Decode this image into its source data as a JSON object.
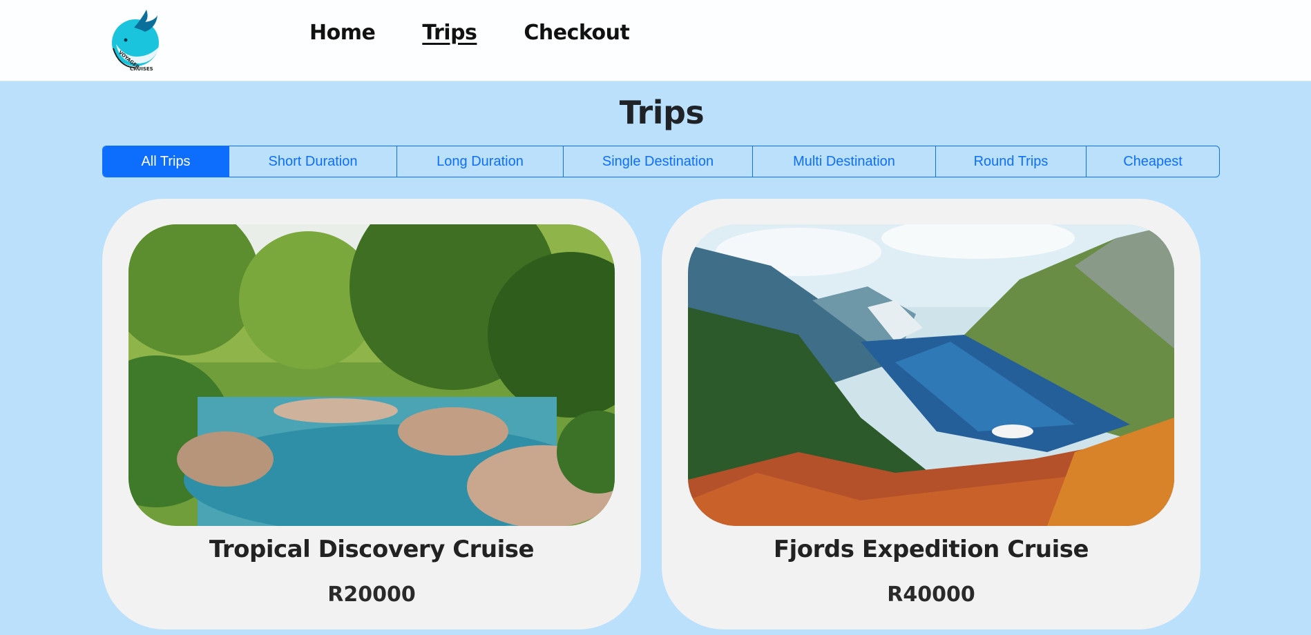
{
  "nav": {
    "home": "Home",
    "trips": "Trips",
    "checkout": "Checkout"
  },
  "page": {
    "title": "Trips"
  },
  "filters": [
    {
      "label": "All Trips",
      "active": true
    },
    {
      "label": "Short Duration",
      "active": false
    },
    {
      "label": "Long Duration",
      "active": false
    },
    {
      "label": "Single Destination",
      "active": false
    },
    {
      "label": "Multi Destination",
      "active": false
    },
    {
      "label": "Round Trips",
      "active": false
    },
    {
      "label": "Cheapest",
      "active": false
    }
  ],
  "trips": [
    {
      "name": "Tropical Discovery Cruise",
      "price": "R20000"
    },
    {
      "name": "Fjords Expedition Cruise",
      "price": "R40000"
    }
  ],
  "colors": {
    "accent": "#0d6efd",
    "page_background": "#bae0fc",
    "card_background": "#f2f2f2"
  }
}
